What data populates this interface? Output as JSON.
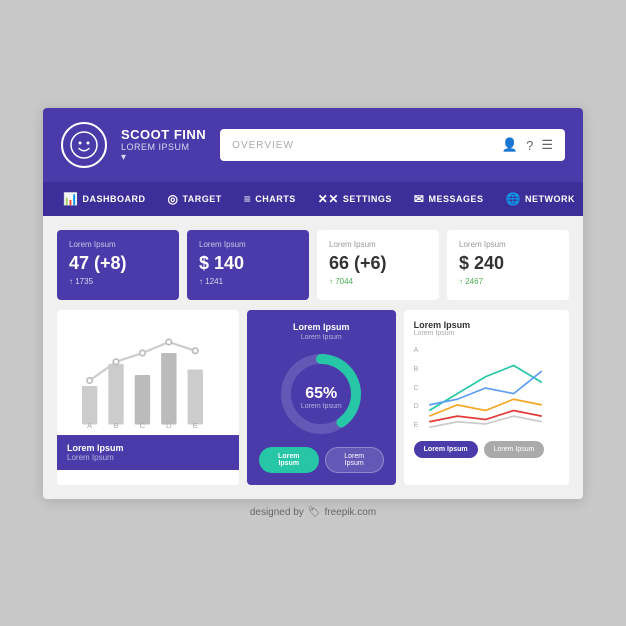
{
  "header": {
    "user_name": "SCOOT FINN",
    "user_sub": "LOREM IPSUM",
    "search_placeholder": "OVERVIEW"
  },
  "nav": {
    "items": [
      {
        "id": "dashboard",
        "label": "DASHBOARD",
        "icon": "📊"
      },
      {
        "id": "target",
        "label": "TARGET",
        "icon": "🎯"
      },
      {
        "id": "charts",
        "label": "CHARTS",
        "icon": "≡"
      },
      {
        "id": "settings",
        "label": "SETTINGS",
        "icon": "✕✕"
      },
      {
        "id": "messages",
        "label": "MESSAGES",
        "icon": "✉"
      },
      {
        "id": "network",
        "label": "NETWORK",
        "icon": "🌐"
      }
    ]
  },
  "stats": [
    {
      "label": "Lorem Ipsum",
      "value": "47 (+8)",
      "change": "↑ 1735",
      "trend": "up",
      "purple": true
    },
    {
      "label": "Lorem Ipsum",
      "value": "$ 140",
      "change": "↑ 1241",
      "trend": "up",
      "purple": true
    },
    {
      "label": "Lorem Ipsum",
      "value": "66 (+6)",
      "change": "↑ 7044",
      "trend": "up",
      "purple": false
    },
    {
      "label": "Lorem Ipsum",
      "value": "$ 240",
      "change": "↑ 2467",
      "trend": "up",
      "purple": false
    }
  ],
  "charts": {
    "bar_line": {
      "footer_title": "Lorem Ipsum",
      "footer_sub": "Lorem Ipsum",
      "labels": [
        "A",
        "B",
        "C",
        "D",
        "E"
      ]
    },
    "donut": {
      "title": "Lorem Ipsum",
      "sub": "Lorem Ipsum",
      "percent": "65%",
      "percent_sub": "Lorem Ipsum",
      "btn1": "Lorem Ipsum",
      "btn2": "Lorem Ipsum"
    },
    "line": {
      "title": "Lorem Ipsum",
      "sub": "Lorem Ipsum",
      "y_labels": [
        "A",
        "B",
        "C",
        "D",
        "E"
      ],
      "btn1": "Lorem Ipsum",
      "btn2": "Lorem Ipsum"
    }
  },
  "footer": {
    "text": "designed by",
    "brand": "freepik.com"
  }
}
